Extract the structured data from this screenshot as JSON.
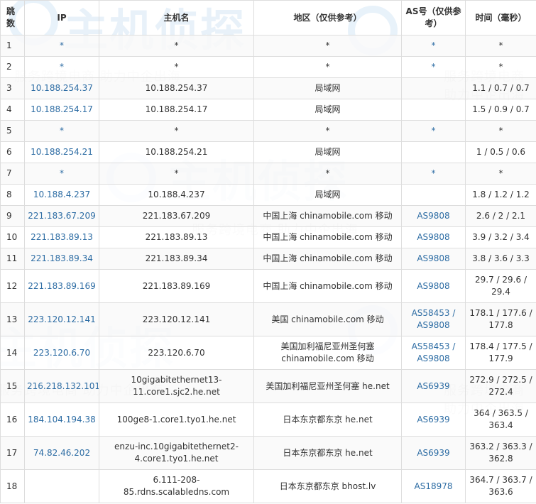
{
  "table": {
    "headers": [
      "跳数",
      "IP",
      "主机名",
      "地区（仅供参考）",
      "AS号（仅供参考）",
      "时间（毫秒）"
    ],
    "rows": [
      {
        "hop": "1",
        "ip": "*",
        "host": "*",
        "region": "*",
        "as": "*",
        "time": "*"
      },
      {
        "hop": "2",
        "ip": "*",
        "host": "*",
        "region": "*",
        "as": "*",
        "time": "*"
      },
      {
        "hop": "3",
        "ip": "10.188.254.37",
        "host": "10.188.254.37",
        "region": "局域网",
        "as": "",
        "time": "1.1 / 0.7 / 0.7"
      },
      {
        "hop": "4",
        "ip": "10.188.254.17",
        "host": "10.188.254.17",
        "region": "局域网",
        "as": "",
        "time": "1.5 / 0.9 / 0.7"
      },
      {
        "hop": "5",
        "ip": "*",
        "host": "*",
        "region": "*",
        "as": "*",
        "time": "*"
      },
      {
        "hop": "6",
        "ip": "10.188.254.21",
        "host": "10.188.254.21",
        "region": "局域网",
        "as": "",
        "time": "1 / 0.5 / 0.6"
      },
      {
        "hop": "7",
        "ip": "*",
        "host": "*",
        "region": "*",
        "as": "*",
        "time": "*"
      },
      {
        "hop": "8",
        "ip": "10.188.4.237",
        "host": "10.188.4.237",
        "region": "局域网",
        "as": "",
        "time": "1.8 / 1.2 / 1.2"
      },
      {
        "hop": "9",
        "ip": "221.183.67.209",
        "host": "221.183.67.209",
        "region": "中国上海 chinamobile.com 移动",
        "as": "AS9808",
        "time": "2.6 / 2 / 2.1"
      },
      {
        "hop": "10",
        "ip": "221.183.89.13",
        "host": "221.183.89.13",
        "region": "中国上海 chinamobile.com 移动",
        "as": "AS9808",
        "time": "3.9 / 3.2 / 3.4"
      },
      {
        "hop": "11",
        "ip": "221.183.89.34",
        "host": "221.183.89.34",
        "region": "中国上海 chinamobile.com 移动",
        "as": "AS9808",
        "time": "3.8 / 3.6 / 3.3"
      },
      {
        "hop": "12",
        "ip": "221.183.89.169",
        "host": "221.183.89.169",
        "region": "中国上海 chinamobile.com 移动",
        "as": "AS9808",
        "time": "29.7 / 29.6 / 29.4"
      },
      {
        "hop": "13",
        "ip": "223.120.12.141",
        "host": "223.120.12.141",
        "region": "美国 chinamobile.com 移动",
        "as": "AS58453 / AS9808",
        "time": "178.1 / 177.6 / 177.8"
      },
      {
        "hop": "14",
        "ip": "223.120.6.70",
        "host": "223.120.6.70",
        "region": "美国加利福尼亚州圣何塞 chinamobile.com 移动",
        "as": "AS58453 / AS9808",
        "time": "178.4 / 177.5 / 177.9"
      },
      {
        "hop": "15",
        "ip": "216.218.132.101",
        "host": "10gigabitethernet13-11.core1.sjc2.he.net",
        "region": "美国加利福尼亚州圣何塞 he.net",
        "as": "AS6939",
        "time": "272.9 / 272.5 / 272.4"
      },
      {
        "hop": "16",
        "ip": "184.104.194.38",
        "host": "100ge8-1.core1.tyo1.he.net",
        "region": "日本东京都东京 he.net",
        "as": "AS6939",
        "time": "364 / 363.5 / 363.4"
      },
      {
        "hop": "17",
        "ip": "74.82.46.202",
        "host": "enzu-inc.10gigabitethernet2-4.core1.tyo1.he.net",
        "region": "日本东京都东京 he.net",
        "as": "AS6939",
        "time": "363.2 / 363.3 / 362.8"
      },
      {
        "hop": "18",
        "ip": "",
        "host": "6.111-208-85.rdns.scalabledns.com",
        "region": "日本东京都东京 bhost.lv",
        "as": "AS18978",
        "time": "364.7 / 363.7 / 363.6"
      }
    ]
  },
  "watermark": {
    "logo": "主机侦探",
    "slogan": "服务跨境电商 助力中企出海"
  },
  "colors": {
    "link": "#2e6da4",
    "border": "#dddddd",
    "text": "#333333",
    "watermark_blue": "#d6e7f5"
  }
}
